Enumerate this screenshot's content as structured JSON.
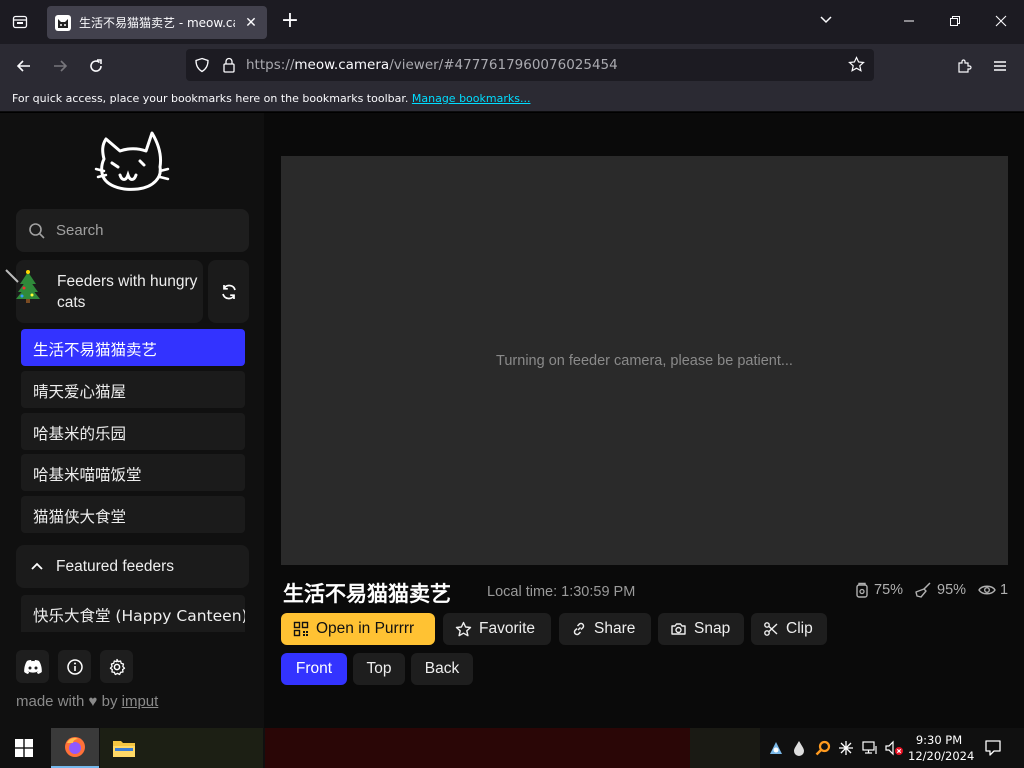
{
  "browser": {
    "tab_title": "生活不易猫猫卖艺 - meow.camera",
    "url_prefix": "https://",
    "url_host": "meow.camera",
    "url_path": "/viewer/#4777617960076025454",
    "bookmarks_message": "For quick access, place your bookmarks here on the bookmarks toolbar.",
    "bookmarks_link": "Manage bookmarks..."
  },
  "sidebar": {
    "search_placeholder": "Search",
    "group_label": "Feeders with hungry cats",
    "feeders": [
      {
        "label": "生活不易猫猫卖艺",
        "active": true
      },
      {
        "label": "晴天爱心猫屋",
        "active": false
      },
      {
        "label": "哈基米的乐园",
        "active": false
      },
      {
        "label": "哈基米喵喵饭堂",
        "active": false
      },
      {
        "label": "猫猫侠大食堂",
        "active": false
      }
    ],
    "featured_label": "Featured feeders",
    "featured_items": [
      "快乐大食堂 (Happy Canteen)"
    ],
    "made_with_prefix": "made with",
    "made_with_by": "by",
    "made_with_link": "imput"
  },
  "main": {
    "video_message": "Turning on feeder camera, please be patient...",
    "feeder_title": "生活不易猫猫卖艺",
    "local_time": "Local time: 1:30:59 PM",
    "stats": {
      "food": "75%",
      "clean": "95%",
      "viewers": "1"
    },
    "actions": {
      "open": "Open in Purrrr",
      "favorite": "Favorite",
      "share": "Share",
      "snap": "Snap",
      "clip": "Clip"
    },
    "views": [
      {
        "label": "Front",
        "active": true
      },
      {
        "label": "Top",
        "active": false
      },
      {
        "label": "Back",
        "active": false
      }
    ]
  },
  "taskbar": {
    "time": "9:30 PM",
    "date": "12/20/2024"
  },
  "colors": {
    "accent": "#3333ff",
    "primary_button": "#ffc233"
  }
}
